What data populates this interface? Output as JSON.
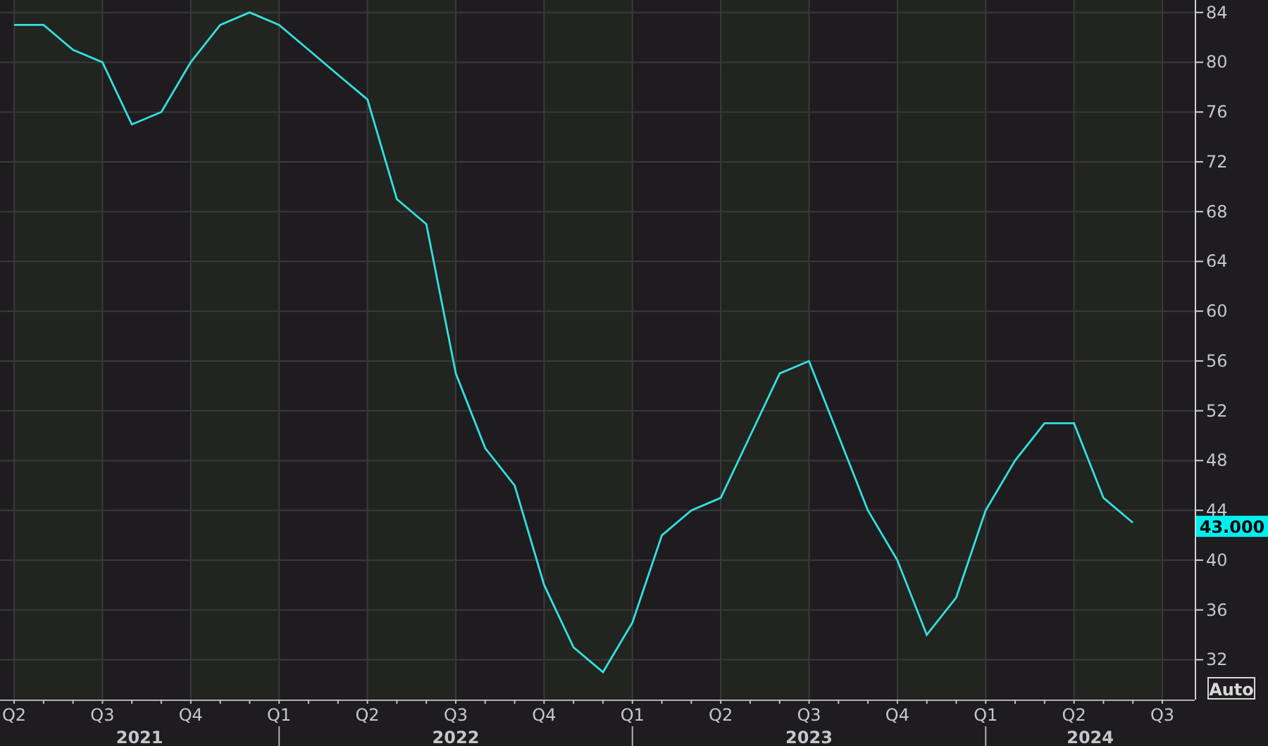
{
  "chart_data": {
    "type": "line",
    "grid": true,
    "ylim": [
      28.8,
      85
    ],
    "yticks": [
      32,
      36,
      40,
      44,
      48,
      52,
      56,
      60,
      64,
      68,
      72,
      76,
      80,
      84
    ],
    "categories": [
      "Q2",
      null,
      null,
      "Q3",
      null,
      null,
      "Q4",
      null,
      null,
      "Q1",
      null,
      null,
      "Q2",
      null,
      null,
      "Q3",
      null,
      null,
      "Q4",
      null,
      null,
      "Q1",
      null,
      null,
      "Q2",
      null,
      null,
      "Q3",
      null,
      null,
      "Q4",
      null,
      null,
      "Q1",
      null,
      null,
      "Q2",
      null,
      null,
      "Q3"
    ],
    "series": [
      {
        "color": "#33e0e0",
        "values": [
          83,
          83,
          81,
          80,
          75,
          76,
          80,
          83,
          84,
          83,
          81,
          79,
          77,
          69,
          67,
          55,
          49,
          46,
          38,
          33,
          31,
          35,
          42,
          44,
          45,
          50,
          55,
          56,
          50,
          44,
          40,
          34,
          37,
          44,
          48,
          51,
          51,
          45,
          43,
          null
        ]
      }
    ]
  },
  "year_labels": [
    "2021",
    "2022",
    "2023",
    "2024"
  ],
  "last_value": {
    "label": "43.000"
  },
  "scale_button": {
    "label": "Auto"
  }
}
